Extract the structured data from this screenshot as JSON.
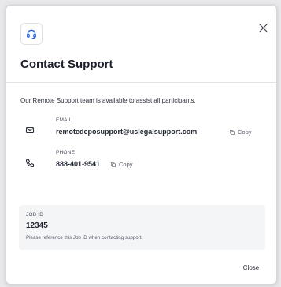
{
  "modal": {
    "header_icon": "headset-icon",
    "close_icon": "close-icon",
    "title": "Contact Support",
    "intro": "Our Remote Support team is available to assist all participants.",
    "email": {
      "label": "EMAIL",
      "value": "remotedeposupport@uslegalsupport.com",
      "icon": "mail-icon",
      "copy_label": "Copy"
    },
    "phone": {
      "label": "PHONE",
      "value": "888-401-9541",
      "icon": "phone-icon",
      "copy_label": "Copy"
    },
    "job": {
      "label": "JOB ID",
      "value": "12345",
      "note": "Please reference this Job ID when contacting support."
    },
    "close_button_label": "Close"
  }
}
